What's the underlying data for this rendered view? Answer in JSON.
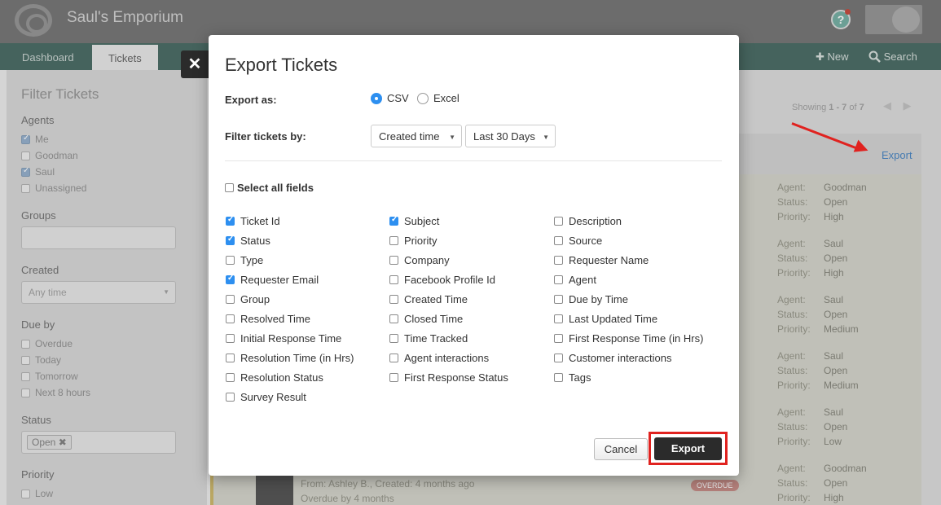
{
  "app": {
    "title": "Saul's Emporium"
  },
  "nav": {
    "tabs": [
      "Dashboard",
      "Tickets"
    ],
    "new_label": "New",
    "search_label": "Search"
  },
  "sidebar": {
    "title": "Filter Tickets",
    "agents_label": "Agents",
    "agents": [
      {
        "label": "Me",
        "checked": true
      },
      {
        "label": "Goodman",
        "checked": false
      },
      {
        "label": "Saul",
        "checked": true
      },
      {
        "label": "Unassigned",
        "checked": false
      }
    ],
    "groups_label": "Groups",
    "created_label": "Created",
    "created_value": "Any time",
    "dueby_label": "Due by",
    "dueby": [
      "Overdue",
      "Today",
      "Tomorrow",
      "Next 8 hours"
    ],
    "status_label": "Status",
    "status_tag": "Open",
    "priority_label": "Priority",
    "priority_first": "Low"
  },
  "content": {
    "showing_prefix": "Showing",
    "showing_range": "1 - 7",
    "showing_of": "of",
    "showing_total": "7",
    "export_link": "Export",
    "meta_keys": [
      "Agent:",
      "Status:",
      "Priority:"
    ],
    "tickets": [
      {
        "agent": "Goodman",
        "status": "Open",
        "priority": "High"
      },
      {
        "agent": "Saul",
        "status": "Open",
        "priority": "High"
      },
      {
        "agent": "Saul",
        "status": "Open",
        "priority": "Medium"
      },
      {
        "agent": "Saul",
        "status": "Open",
        "priority": "Medium"
      },
      {
        "agent": "Saul",
        "status": "Open",
        "priority": "Low"
      },
      {
        "agent": "Goodman",
        "status": "Open",
        "priority": "High"
      }
    ],
    "last_ticket_from": "From: Ashley B., Created: 4 months ago",
    "last_ticket_overdue": "Overdue by 4 months",
    "overdue_badge": "OVERDUE"
  },
  "modal": {
    "title": "Export Tickets",
    "export_as_label": "Export as:",
    "formats": [
      {
        "label": "CSV",
        "selected": true
      },
      {
        "label": "Excel",
        "selected": false
      }
    ],
    "filter_label": "Filter tickets by:",
    "filter_field": "Created time",
    "filter_range": "Last 30 Days",
    "select_all_label": "Select all fields",
    "columns": [
      [
        {
          "label": "Ticket Id",
          "checked": true
        },
        {
          "label": "Status",
          "checked": true
        },
        {
          "label": "Type",
          "checked": false
        },
        {
          "label": "Requester Email",
          "checked": true
        },
        {
          "label": "Group",
          "checked": false
        },
        {
          "label": "Resolved Time",
          "checked": false
        },
        {
          "label": "Initial Response Time",
          "checked": false
        },
        {
          "label": "Resolution Time (in Hrs)",
          "checked": false
        },
        {
          "label": "Resolution Status",
          "checked": false
        },
        {
          "label": "Survey Result",
          "checked": false
        }
      ],
      [
        {
          "label": "Subject",
          "checked": true
        },
        {
          "label": "Priority",
          "checked": false
        },
        {
          "label": "Company",
          "checked": false
        },
        {
          "label": "Facebook Profile Id",
          "checked": false
        },
        {
          "label": "Created Time",
          "checked": false
        },
        {
          "label": "Closed Time",
          "checked": false
        },
        {
          "label": "Time Tracked",
          "checked": false
        },
        {
          "label": "Agent interactions",
          "checked": false
        },
        {
          "label": "First Response Status",
          "checked": false
        }
      ],
      [
        {
          "label": "Description",
          "checked": false
        },
        {
          "label": "Source",
          "checked": false
        },
        {
          "label": "Requester Name",
          "checked": false
        },
        {
          "label": "Agent",
          "checked": false
        },
        {
          "label": "Due by Time",
          "checked": false
        },
        {
          "label": "Last Updated Time",
          "checked": false
        },
        {
          "label": "First Response Time (in Hrs)",
          "checked": false
        },
        {
          "label": "Customer interactions",
          "checked": false
        },
        {
          "label": "Tags",
          "checked": false
        }
      ]
    ],
    "cancel_label": "Cancel",
    "export_label": "Export",
    "close_symbol": "✕"
  },
  "colors": {
    "accent": "#2d8ff0",
    "highlight": "#e0221f",
    "nav": "#3a5f57",
    "topbar": "#6a6a6a"
  },
  "icons": [
    "app-logo-icon",
    "help-icon",
    "plus-icon",
    "search-icon",
    "close-icon",
    "chevron-down-icon",
    "arrow-annotation-icon"
  ]
}
